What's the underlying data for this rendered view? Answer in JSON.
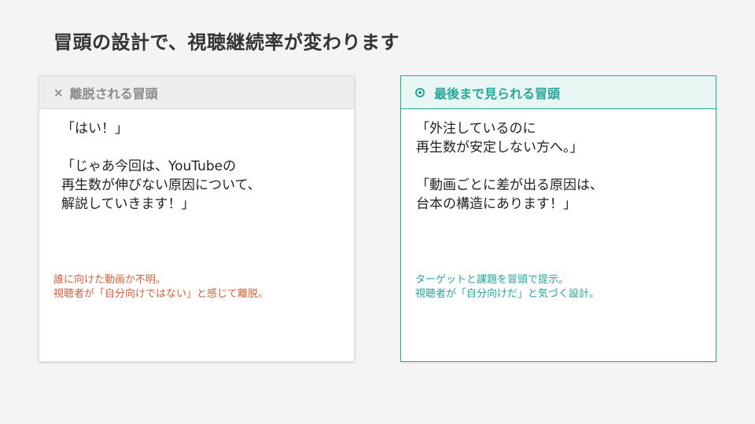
{
  "title": "冒頭の設計で、視聴継続率が変わります",
  "bad": {
    "header_icon": "×",
    "header_label": "離脱される冒頭",
    "quotes": [
      "「はい！」",
      "「じゃあ今回は、YouTubeの\n再生数が伸びない原因について、\n解説していきます！」"
    ],
    "note": "誰に向けた動画か不明。\n視聴者が「自分向けではない」と感じて離脱。",
    "accent_color": "#d0613c"
  },
  "good": {
    "header_icon": "circle-icon",
    "header_label": "最後まで見られる冒頭",
    "quotes": [
      "「外注しているのに\n再生数が安定しない方へ。」",
      "「動画ごとに差が出る原因は、\n台本の構造にあります！」"
    ],
    "note": "ターゲットと課題を冒頭で提示。\n視聴者が「自分向けだ」と気づく設計。",
    "accent_color": "#2aa59a"
  }
}
